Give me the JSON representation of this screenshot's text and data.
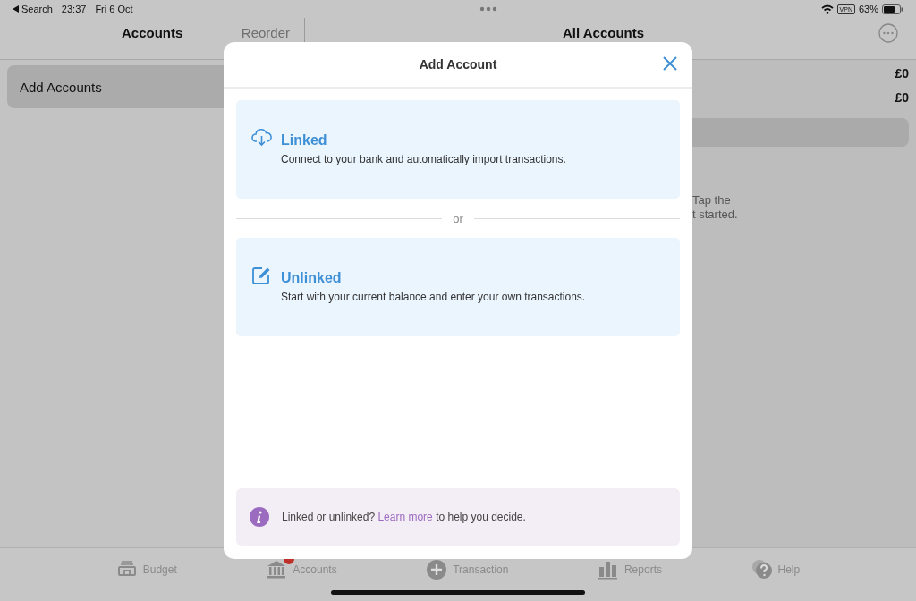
{
  "status_bar": {
    "back": "Search",
    "time": "23:37",
    "date": "Fri 6 Oct",
    "vpn": "VPN",
    "battery": "63%"
  },
  "left_pane": {
    "title": "Accounts",
    "action": "Reorder",
    "items": [
      {
        "label": "Add Accounts",
        "selected": true
      }
    ]
  },
  "right_pane": {
    "title": "All Accounts",
    "amounts": [
      "£0",
      "£0"
    ],
    "hint_lines": [
      "Tap the",
      "t started."
    ]
  },
  "modal": {
    "title": "Add Account",
    "options": [
      {
        "kind": "linked",
        "title": "Linked",
        "description": "Connect to your bank and automatically import transactions."
      },
      {
        "kind": "unlinked",
        "title": "Unlinked",
        "description": "Start with your current balance and enter your own transactions."
      }
    ],
    "separator": "or",
    "info": {
      "before": "Linked or unlinked?",
      "link": "Learn more",
      "after": "to help you decide."
    }
  },
  "tab_bar": [
    {
      "kind": "budget",
      "label": "Budget",
      "badge": false
    },
    {
      "kind": "accounts",
      "label": "Accounts",
      "badge": true
    },
    {
      "kind": "transaction",
      "label": "Transaction",
      "badge": false
    },
    {
      "kind": "reports",
      "label": "Reports",
      "badge": false
    },
    {
      "kind": "help",
      "label": "Help",
      "badge": false
    }
  ]
}
